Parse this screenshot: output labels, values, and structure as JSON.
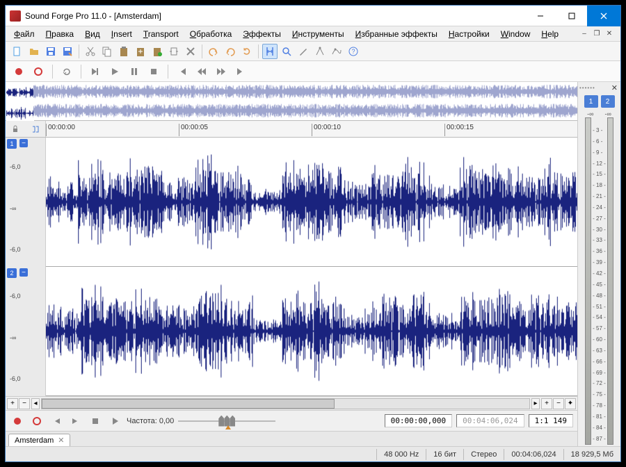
{
  "title": "Sound Forge Pro 11.0 - [Amsterdam]",
  "menu": [
    "Файл",
    "Правка",
    "Вид",
    "Insert",
    "Transport",
    "Обработка",
    "Эффекты",
    "Инструменты",
    "Избранные эффекты",
    "Настройки",
    "Window",
    "Help"
  ],
  "menu_ul": [
    0,
    0,
    0,
    0,
    0,
    0,
    0,
    0,
    0,
    0,
    0,
    0
  ],
  "childctl": [
    "–",
    "❐",
    "✕"
  ],
  "toolbar1": [
    {
      "n": "new-file-icon",
      "c": "#4f9fe2"
    },
    {
      "n": "open-folder-icon",
      "c": "#e2b24f"
    },
    {
      "n": "save-icon",
      "c": "#4f7fe2"
    },
    {
      "n": "save-as-icon",
      "c": "#4f7fe2"
    },
    {
      "sep": true
    },
    {
      "n": "cut-icon",
      "c": "#888"
    },
    {
      "n": "copy-icon",
      "c": "#888"
    },
    {
      "n": "paste-icon",
      "c": "#a8874f"
    },
    {
      "n": "paste-mix-icon",
      "c": "#a8874f"
    },
    {
      "n": "paste-new-icon",
      "c": "#a8874f"
    },
    {
      "n": "trim-icon",
      "c": "#888"
    },
    {
      "n": "delete-icon",
      "c": "#888"
    },
    {
      "sep": true
    },
    {
      "n": "undo-icon",
      "c": "#e29a4f"
    },
    {
      "n": "redo-icon",
      "c": "#e29a4f"
    },
    {
      "n": "repeat-icon",
      "c": "#e29a4f"
    },
    {
      "sep": true
    },
    {
      "n": "selection-tool-icon",
      "c": "#4f7fe2",
      "active": true
    },
    {
      "n": "magnify-tool-icon",
      "c": "#4f7fe2"
    },
    {
      "n": "draw-tool-icon",
      "c": "#888"
    },
    {
      "n": "event-tool-icon",
      "c": "#888"
    },
    {
      "n": "envelope-tool-icon",
      "c": "#888"
    },
    {
      "n": "help-icon",
      "c": "#4f7fe2"
    }
  ],
  "transport": [
    {
      "n": "record-icon",
      "c": "#d43a3a",
      "shape": "circle"
    },
    {
      "n": "record-arm-icon",
      "c": "#d43a3a",
      "shape": "ring"
    },
    {
      "sep": true
    },
    {
      "n": "loop-icon",
      "c": "#888",
      "shape": "loop"
    },
    {
      "sep": true
    },
    {
      "n": "play-all-icon",
      "c": "#888",
      "shape": "playall"
    },
    {
      "n": "play-icon",
      "c": "#888",
      "shape": "play"
    },
    {
      "n": "pause-icon",
      "c": "#888",
      "shape": "pause"
    },
    {
      "n": "stop-icon",
      "c": "#888",
      "shape": "stop"
    },
    {
      "sep": true
    },
    {
      "n": "go-start-icon",
      "c": "#888",
      "shape": "gostart"
    },
    {
      "n": "rewind-icon",
      "c": "#888",
      "shape": "rewind"
    },
    {
      "n": "forward-icon",
      "c": "#888",
      "shape": "forward"
    },
    {
      "n": "go-end-icon",
      "c": "#888",
      "shape": "goend"
    }
  ],
  "ruler": [
    "00:00:00",
    "00:00:05",
    "00:00:10",
    "00:00:15"
  ],
  "channels": [
    "1",
    "2"
  ],
  "db_marks": [
    "-6,0",
    "-∞",
    "-6,0"
  ],
  "meter_header": [
    "-∞",
    "-∞"
  ],
  "meter_scale": [
    "- 3 -",
    "- 6 -",
    "- 9 -",
    "- 12 -",
    "- 15 -",
    "- 18 -",
    "- 21 -",
    "- 24 -",
    "- 27 -",
    "- 30 -",
    "- 33 -",
    "- 36 -",
    "- 39 -",
    "- 42 -",
    "- 45 -",
    "- 48 -",
    "- 51 -",
    "- 54 -",
    "- 57 -",
    "- 60 -",
    "- 63 -",
    "- 66 -",
    "- 69 -",
    "- 72 -",
    "- 75 -",
    "- 78 -",
    "- 81 -",
    "- 84 -",
    "- 87 -"
  ],
  "bottom_transport": {
    "rate_label": "Частота: 0,00",
    "time_current": "00:00:00,000",
    "time_total": "00:04:06,024",
    "zoom": "1:1 149"
  },
  "doc_tab": "Amsterdam",
  "status": {
    "hz": "48 000 Hz",
    "bit": "16 бит",
    "stereo": "Стерео",
    "length": "00:04:06,024",
    "size": "18 929,5 Мб"
  },
  "colors": {
    "wave": "#1a237e",
    "overview": "#9fa6cf"
  }
}
